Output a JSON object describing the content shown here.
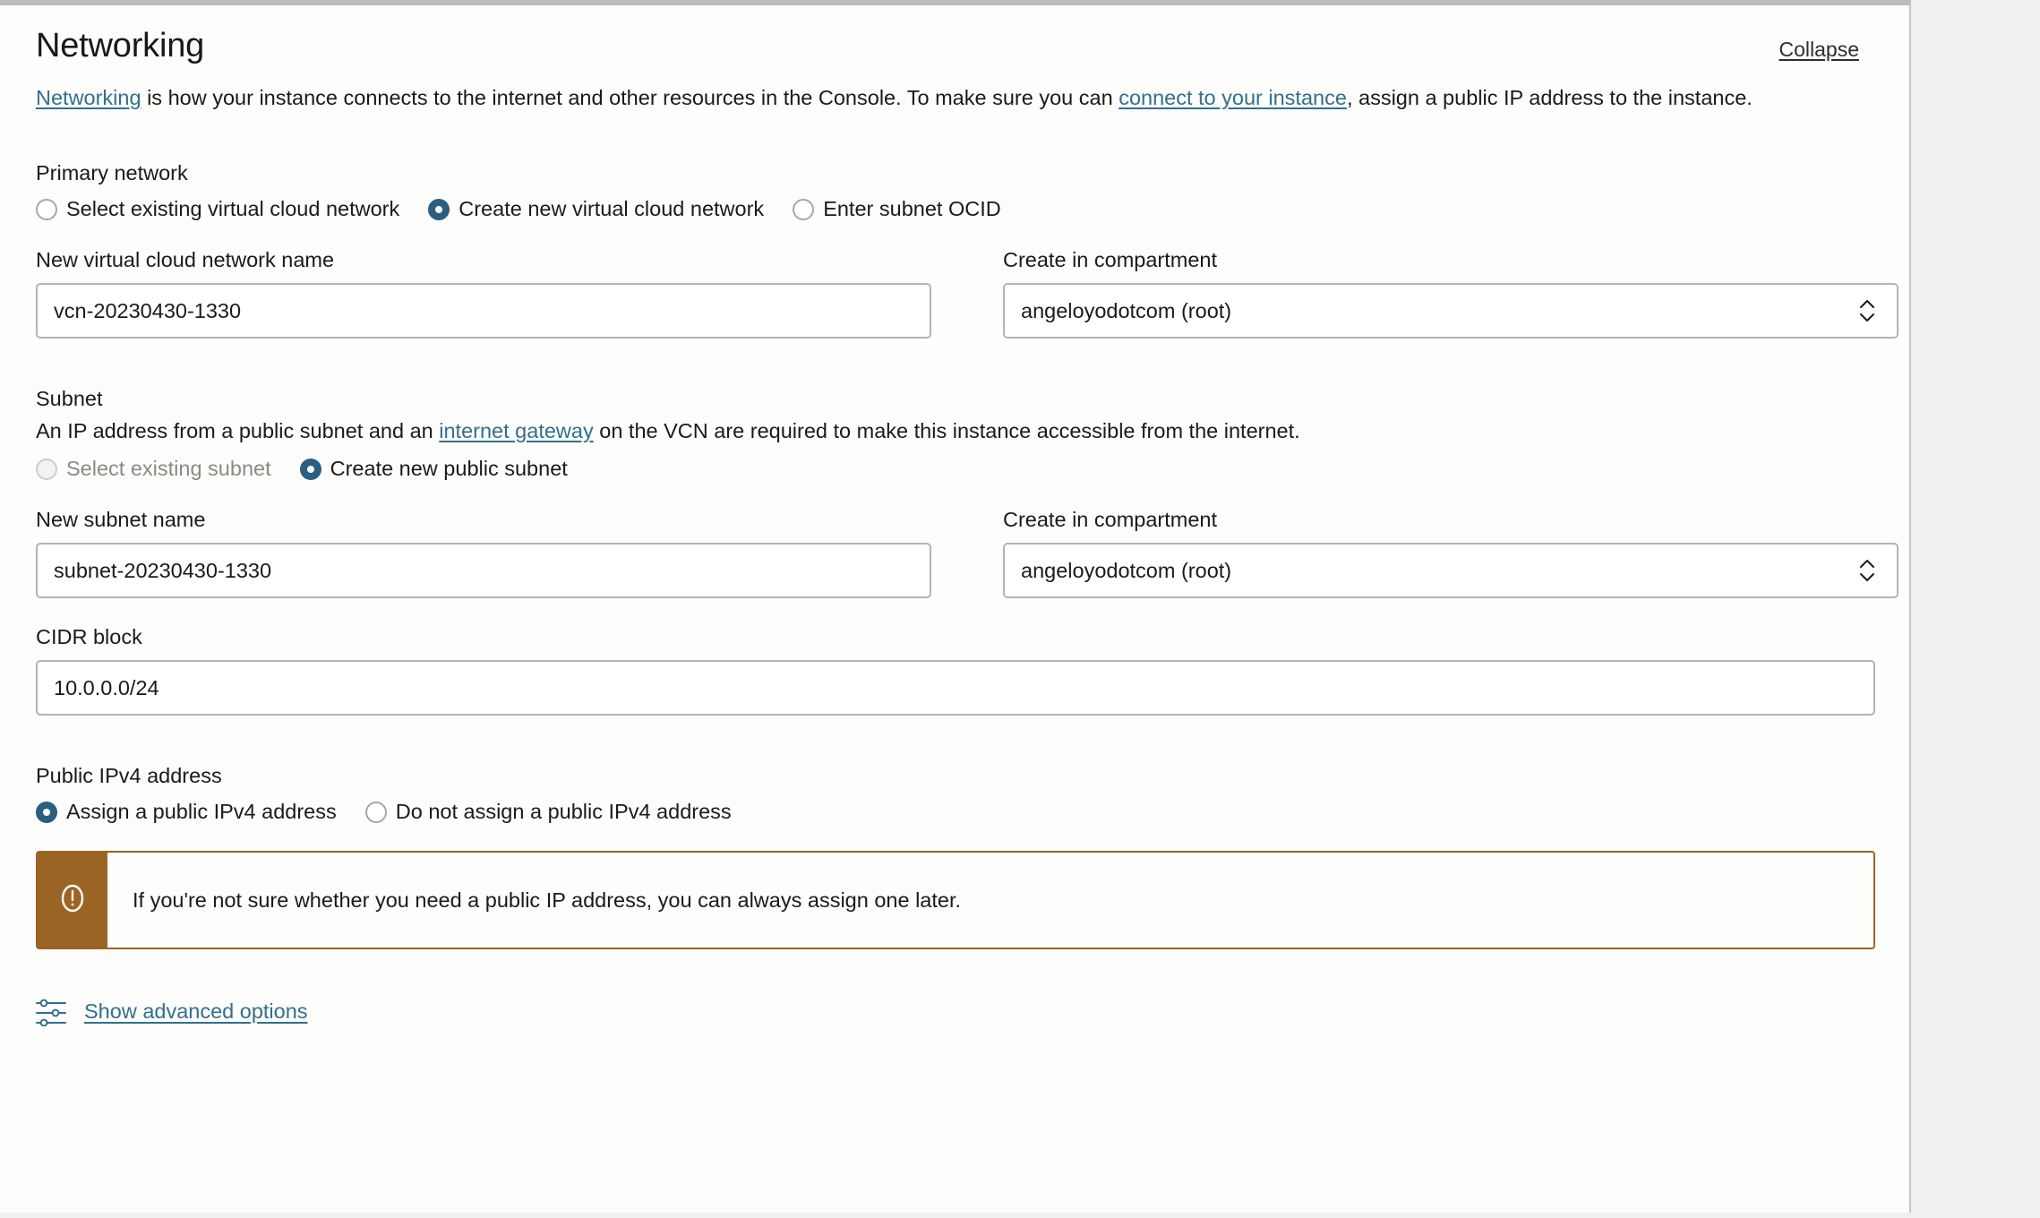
{
  "section": {
    "title": "Networking",
    "collapse_label": "Collapse",
    "description": {
      "link1": "Networking",
      "part1": " is how your instance connects to the internet and other resources in the Console. To make sure you can ",
      "link2": "connect to your instance",
      "part2": ", assign a public IP address to the instance."
    }
  },
  "primary_network": {
    "label": "Primary network",
    "options": [
      {
        "label": "Select existing virtual cloud network",
        "checked": false,
        "disabled": false
      },
      {
        "label": "Create new virtual cloud network",
        "checked": true,
        "disabled": false
      },
      {
        "label": "Enter subnet OCID",
        "checked": false,
        "disabled": false
      }
    ],
    "vcn_name": {
      "label": "New virtual cloud network name",
      "value": "vcn-20230430-1330"
    },
    "compartment": {
      "label": "Create in compartment",
      "value": "angeloyodotcom (root)"
    }
  },
  "subnet": {
    "label": "Subnet",
    "description": {
      "part1": "An IP address from a public subnet and an ",
      "link": "internet gateway",
      "part2": " on the VCN are required to make this instance accessible from the internet."
    },
    "options": [
      {
        "label": "Select existing subnet",
        "checked": false,
        "disabled": true
      },
      {
        "label": "Create new public subnet",
        "checked": true,
        "disabled": false
      }
    ],
    "subnet_name": {
      "label": "New subnet name",
      "value": "subnet-20230430-1330"
    },
    "compartment": {
      "label": "Create in compartment",
      "value": "angeloyodotcom (root)"
    },
    "cidr": {
      "label": "CIDR block",
      "value": "10.0.0.0/24"
    }
  },
  "public_ip": {
    "label": "Public IPv4 address",
    "options": [
      {
        "label": "Assign a public IPv4 address",
        "checked": true,
        "disabled": false
      },
      {
        "label": "Do not assign a public IPv4 address",
        "checked": false,
        "disabled": false
      }
    ],
    "banner": {
      "icon": "exclamation-circle-icon",
      "text": "If you're not sure whether you need a public IP address, you can always assign one later."
    }
  },
  "advanced": {
    "icon": "sliders-icon",
    "label": "Show advanced options"
  },
  "colors": {
    "accent_blue": "#2a5f81",
    "link_blue": "#31708e",
    "warning_brown": "#9a6524",
    "card_bg": "#fdfdfb",
    "page_bg": "#f0f0ee",
    "border_gray": "#b6b3b0"
  }
}
